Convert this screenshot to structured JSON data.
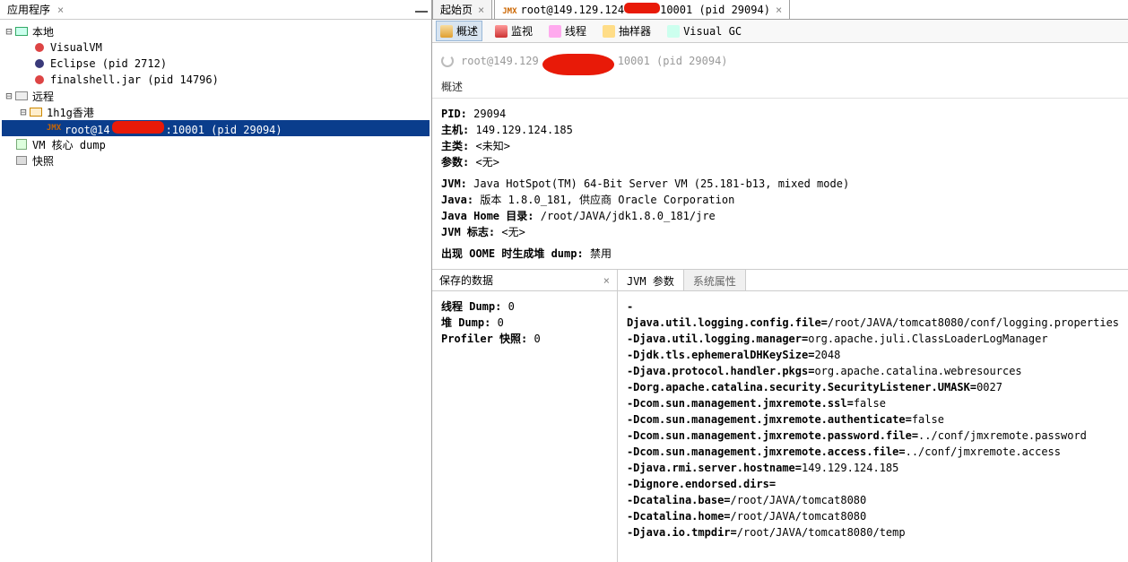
{
  "left": {
    "title": "应用程序",
    "tree": {
      "local": "本地",
      "visualvm": "VisualVM",
      "eclipse": "Eclipse (pid 2712)",
      "finalshell": "finalshell.jar (pid 14796)",
      "remote": "远程",
      "hk": "1h1g香港",
      "selected_pre": "root@14",
      "selected_post": ":10001 (pid 29094)",
      "vmcore": "VM 核心 dump",
      "snapshot": "快照"
    }
  },
  "tabs": {
    "start": "起始页",
    "conn_pre": "root@149.129.124",
    "conn_post": "10001 (pid 29094)"
  },
  "subtabs": {
    "overview": "概述",
    "monitor": "监视",
    "thread": "线程",
    "sampler": "抽样器",
    "visualgc": "Visual GC"
  },
  "title": {
    "pre": "root@149.129",
    "post": "10001 (pid 29094)"
  },
  "section_overview": "概述",
  "info": {
    "pid_l": "PID:",
    "pid_v": "29094",
    "host_l": "主机:",
    "host_v": "149.129.124.185",
    "class_l": "主类:",
    "class_v": "<未知>",
    "args_l": "参数:",
    "args_v": "<无>",
    "jvm_l": "JVM:",
    "jvm_v": "Java HotSpot(TM) 64-Bit Server VM (25.181-b13, mixed mode)",
    "java_l": "Java:",
    "java_v": "版本 1.8.0_181, 供应商 Oracle Corporation",
    "jhome_l": "Java Home 目录:",
    "jhome_v": "/root/JAVA/jdk1.8.0_181/jre",
    "jflag_l": "JVM 标志:",
    "jflag_v": "<无>",
    "oome_l": "出现 OOME 时生成堆 dump:",
    "oome_v": "禁用"
  },
  "saved": {
    "title": "保存的数据",
    "thread_dump_l": "线程 Dump:",
    "thread_dump_v": "0",
    "heap_dump_l": "堆 Dump:",
    "heap_dump_v": "0",
    "profiler_l": "Profiler 快照:",
    "profiler_v": "0"
  },
  "jvmargs": {
    "tab_active": "JVM 参数",
    "tab_inactive": "系统属性",
    "args": [
      {
        "k": "-Djava.util.logging.config.file=",
        "v": "/root/JAVA/tomcat8080/conf/logging.properties"
      },
      {
        "k": "-Djava.util.logging.manager=",
        "v": "org.apache.juli.ClassLoaderLogManager"
      },
      {
        "k": "-Djdk.tls.ephemeralDHKeySize=",
        "v": "2048"
      },
      {
        "k": "-Djava.protocol.handler.pkgs=",
        "v": "org.apache.catalina.webresources"
      },
      {
        "k": "-Dorg.apache.catalina.security.SecurityListener.UMASK=",
        "v": "0027"
      },
      {
        "k": "-Dcom.sun.management.jmxremote.ssl=",
        "v": "false"
      },
      {
        "k": "-Dcom.sun.management.jmxremote.authenticate=",
        "v": "false"
      },
      {
        "k": "-Dcom.sun.management.jmxremote.password.file=",
        "v": "../conf/jmxremote.password"
      },
      {
        "k": "-Dcom.sun.management.jmxremote.access.file=",
        "v": "../conf/jmxremote.access"
      },
      {
        "k": "-Djava.rmi.server.hostname=",
        "v": "149.129.124.185"
      },
      {
        "k": "-Dignore.endorsed.dirs=",
        "v": ""
      },
      {
        "k": "-Dcatalina.base=",
        "v": "/root/JAVA/tomcat8080"
      },
      {
        "k": "-Dcatalina.home=",
        "v": "/root/JAVA/tomcat8080"
      },
      {
        "k": "-Djava.io.tmpdir=",
        "v": "/root/JAVA/tomcat8080/temp"
      }
    ]
  }
}
